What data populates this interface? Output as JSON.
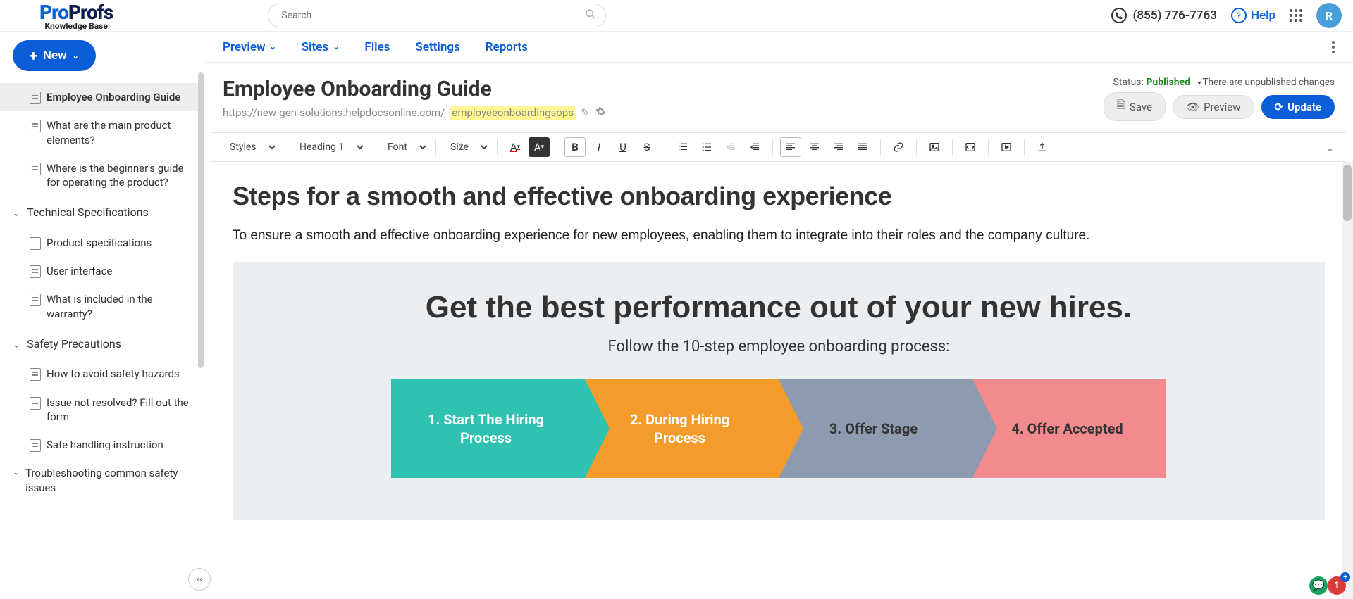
{
  "header": {
    "logo_word1": "Pro",
    "logo_word2": "Profs",
    "logo_subtitle": "Knowledge Base",
    "search_placeholder": "Search",
    "phone": "(855) 776-7763",
    "help_label": "Help",
    "avatar_letter": "R"
  },
  "sidebar": {
    "new_button": "New",
    "items": [
      {
        "label": "Employee Onboarding Guide",
        "active": true
      },
      {
        "label": "What are the main product elements?"
      },
      {
        "label": "Where is the beginner's guide for operating the product?"
      }
    ],
    "cat1": {
      "label": "Technical Specifications",
      "items": [
        {
          "label": "Product specifications"
        },
        {
          "label": "User interface"
        },
        {
          "label": "What is included in the warranty?"
        }
      ]
    },
    "cat2": {
      "label": "Safety Precautions",
      "items": [
        {
          "label": "How to avoid safety hazards"
        },
        {
          "label": "Issue not resolved? Fill out the form"
        },
        {
          "label": "Safe handling instruction"
        },
        {
          "label": "Troubleshooting common safety issues"
        }
      ]
    }
  },
  "subnav": {
    "preview": "Preview",
    "sites": "Sites",
    "files": "Files",
    "settings": "Settings",
    "reports": "Reports"
  },
  "page": {
    "title": "Employee Onboarding Guide",
    "url_base": "https://new-gen-solutions.helpdocsonline.com/",
    "url_slug": "employeeonboardingsops",
    "status_label": "Status:",
    "status_value": "Published",
    "status_note": "There are unpublished changes",
    "save_label": "Save",
    "preview_label": "Preview",
    "update_label": "Update"
  },
  "toolbar": {
    "styles": "Styles",
    "heading": "Heading 1",
    "font": "Font",
    "size": "Size"
  },
  "editor": {
    "h1": "Steps for a smooth and effective onboarding experience",
    "lead": "To ensure a smooth and effective onboarding experience for new employees, enabling them to integrate into their roles and the company culture.",
    "ig_title": "Get the best performance out of your new hires.",
    "ig_sub": "Follow the 10-step employee onboarding process:",
    "steps": [
      {
        "label": "1. Start The Hiring Process"
      },
      {
        "label": "2. During Hiring Process"
      },
      {
        "label": "3. Offer Stage"
      },
      {
        "label": "4. Offer Accepted"
      }
    ]
  }
}
